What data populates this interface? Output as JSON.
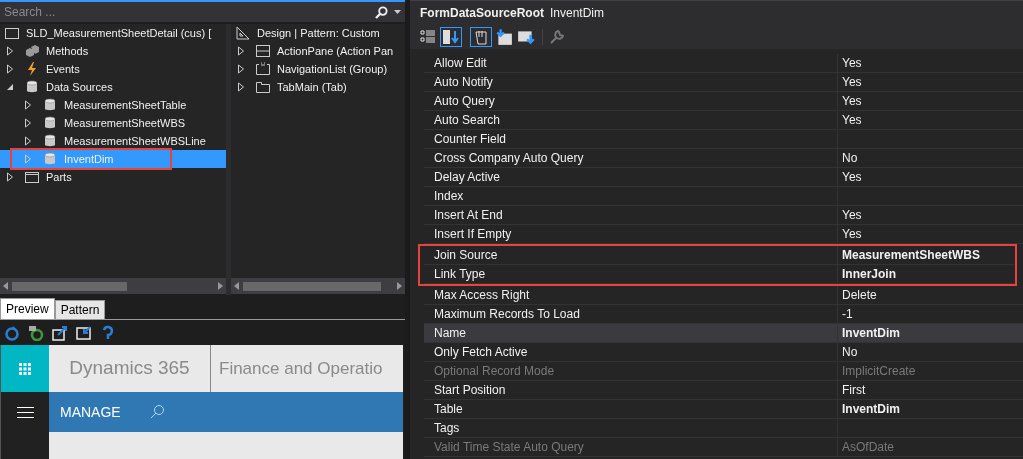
{
  "search": {
    "placeholder": "Search ..."
  },
  "tree_left": [
    {
      "label": "SLD_MeasurementSheetDetail (cus) [",
      "kind": "form",
      "children": [
        {
          "label": "Methods",
          "kind": "methods",
          "expanded": false,
          "selected": false,
          "outlined": false
        },
        {
          "label": "Events",
          "kind": "events",
          "expanded": false,
          "selected": false,
          "outlined": false
        },
        {
          "label": "Data Sources",
          "kind": "datasource",
          "expanded": true,
          "selected": false,
          "outlined": false,
          "children": [
            {
              "label": "MeasurementSheetTable",
              "kind": "datasource",
              "expanded": false,
              "selected": false,
              "outlined": false
            },
            {
              "label": "MeasurementSheetWBS",
              "kind": "datasource",
              "expanded": false,
              "selected": false,
              "outlined": false
            },
            {
              "label": "MeasurementSheetWBSLine",
              "kind": "datasource",
              "expanded": false,
              "selected": false,
              "outlined": false
            },
            {
              "label": "InventDim",
              "kind": "datasource",
              "expanded": false,
              "selected": true,
              "outlined": true
            }
          ]
        },
        {
          "label": "Parts",
          "kind": "parts",
          "expanded": false,
          "selected": false,
          "outlined": false
        }
      ]
    }
  ],
  "tree_right": [
    {
      "label": "Design | Pattern: Custom",
      "kind": "design",
      "children": [
        {
          "label": "ActionPane (Action Pan",
          "kind": "actionpane",
          "expanded": false,
          "selected": false,
          "outlined": false
        },
        {
          "label": "NavigationList (Group)",
          "kind": "group",
          "expanded": false,
          "selected": false,
          "outlined": false
        },
        {
          "label": "TabMain (Tab)",
          "kind": "tab",
          "expanded": false,
          "selected": false,
          "outlined": false
        }
      ]
    }
  ],
  "preview": {
    "tabs": [
      {
        "label": "Preview",
        "selected": true
      },
      {
        "label": "Pattern",
        "selected": false
      }
    ],
    "app_name": "Dynamics 365",
    "app_module": "Finance and Operatio",
    "nav_label": "MANAGE"
  },
  "properties": {
    "type": "FormDataSourceRoot",
    "object": "InventDim",
    "rows": [
      {
        "name": "Allow Edit",
        "value": "Yes",
        "bold": false,
        "disabled": false,
        "selected": false,
        "outlined": false
      },
      {
        "name": "Auto Notify",
        "value": "Yes",
        "bold": false,
        "disabled": false,
        "selected": false,
        "outlined": false
      },
      {
        "name": "Auto Query",
        "value": "Yes",
        "bold": false,
        "disabled": false,
        "selected": false,
        "outlined": false
      },
      {
        "name": "Auto Search",
        "value": "Yes",
        "bold": false,
        "disabled": false,
        "selected": false,
        "outlined": false
      },
      {
        "name": "Counter Field",
        "disabled": false,
        "selected": false,
        "outlined": false
      },
      {
        "name": "Cross Company Auto Query",
        "value": "No",
        "bold": false,
        "disabled": false,
        "selected": false,
        "outlined": false
      },
      {
        "name": "Delay Active",
        "value": "Yes",
        "bold": false,
        "disabled": false,
        "selected": false,
        "outlined": false
      },
      {
        "name": "Index",
        "disabled": false,
        "selected": false,
        "outlined": false
      },
      {
        "name": "Insert At End",
        "value": "Yes",
        "bold": false,
        "disabled": false,
        "selected": false,
        "outlined": false
      },
      {
        "name": "Insert If Empty",
        "value": "Yes",
        "bold": false,
        "disabled": false,
        "selected": false,
        "outlined": false
      },
      {
        "name": "Join Source",
        "value": "MeasurementSheetWBS",
        "bold": true,
        "disabled": false,
        "selected": false,
        "outlined": true
      },
      {
        "name": "Link Type",
        "value": "InnerJoin",
        "bold": true,
        "disabled": false,
        "selected": false,
        "outlined": true
      },
      {
        "name": "Max Access Right",
        "value": "Delete",
        "bold": false,
        "disabled": false,
        "selected": false,
        "outlined": false
      },
      {
        "name": "Maximum Records To Load",
        "value": "-1",
        "bold": false,
        "disabled": false,
        "selected": false,
        "outlined": false
      },
      {
        "name": "Name",
        "value": "InventDim",
        "bold": true,
        "disabled": false,
        "selected": true,
        "outlined": false
      },
      {
        "name": "Only Fetch Active",
        "value": "No",
        "bold": false,
        "disabled": false,
        "selected": false,
        "outlined": false
      },
      {
        "name": "Optional Record Mode",
        "value": "ImplicitCreate",
        "bold": false,
        "disabled": true,
        "selected": false,
        "outlined": false
      },
      {
        "name": "Start Position",
        "value": "First",
        "bold": false,
        "disabled": false,
        "selected": false,
        "outlined": false
      },
      {
        "name": "Table",
        "value": "InventDim",
        "bold": true,
        "disabled": false,
        "selected": false,
        "outlined": false
      },
      {
        "name": "Tags",
        "disabled": false,
        "selected": false,
        "outlined": false
      },
      {
        "name": "Valid Time State Auto Query",
        "value": "AsOfDate",
        "bold": false,
        "disabled": true,
        "selected": false,
        "outlined": false
      }
    ]
  }
}
